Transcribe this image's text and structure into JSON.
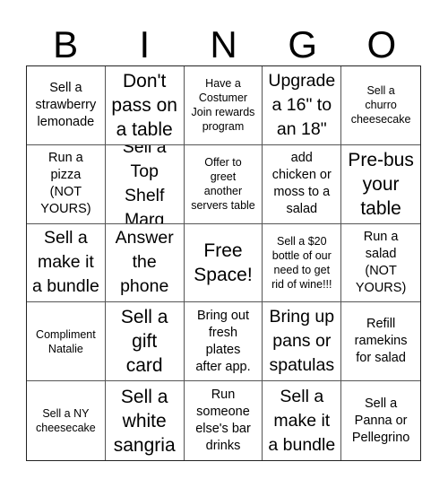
{
  "card": {
    "header": [
      "B",
      "I",
      "N",
      "G",
      "O"
    ],
    "cells": [
      {
        "text": "Sell a\nstrawberry\nlemonade",
        "size": "m"
      },
      {
        "text": "Don't\npass on\na table",
        "size": "xl"
      },
      {
        "text": "Have a\nCostumer\nJoin rewards\nprogram",
        "size": "s"
      },
      {
        "text": "Upgrade\na 16\" to\nan 18\"",
        "size": "l"
      },
      {
        "text": "Sell a\nchurro\ncheesecake",
        "size": "s"
      },
      {
        "text": "Run a\npizza\n(NOT\nYOURS)",
        "size": "m"
      },
      {
        "text": "Sell a\nTop Shelf\nMarg",
        "size": "l"
      },
      {
        "text": "Offer to\ngreet\nanother\nservers table",
        "size": "s"
      },
      {
        "text": "add\nchicken or\nmoss to a\nsalad",
        "size": "m"
      },
      {
        "text": "Pre-bus\nyour\ntable",
        "size": "xl"
      },
      {
        "text": "Sell a\nmake it\na bundle",
        "size": "l"
      },
      {
        "text": "Answer\nthe\nphone",
        "size": "l"
      },
      {
        "text": "Free\nSpace!",
        "size": "xl",
        "free": true
      },
      {
        "text": "Sell a $20\nbottle of our\nneed to get\nrid of wine!!!",
        "size": "s"
      },
      {
        "text": "Run a\nsalad\n(NOT\nYOURS)",
        "size": "m"
      },
      {
        "text": "Compliment\nNatalie",
        "size": "s"
      },
      {
        "text": "Sell a\ngift\ncard",
        "size": "xl"
      },
      {
        "text": "Bring out\nfresh\nplates\nafter app.",
        "size": "m"
      },
      {
        "text": "Bring up\npans or\nspatulas",
        "size": "l"
      },
      {
        "text": "Refill\nramekins\nfor salad",
        "size": "m"
      },
      {
        "text": "Sell a NY\ncheesecake",
        "size": "s"
      },
      {
        "text": "Sell a\nwhite\nsangria",
        "size": "xl"
      },
      {
        "text": "Run\nsomeone\nelse's bar\ndrinks",
        "size": "m"
      },
      {
        "text": "Sell a\nmake it\na bundle",
        "size": "l"
      },
      {
        "text": "Sell a\nPanna or\nPellegrino",
        "size": "m"
      }
    ]
  }
}
